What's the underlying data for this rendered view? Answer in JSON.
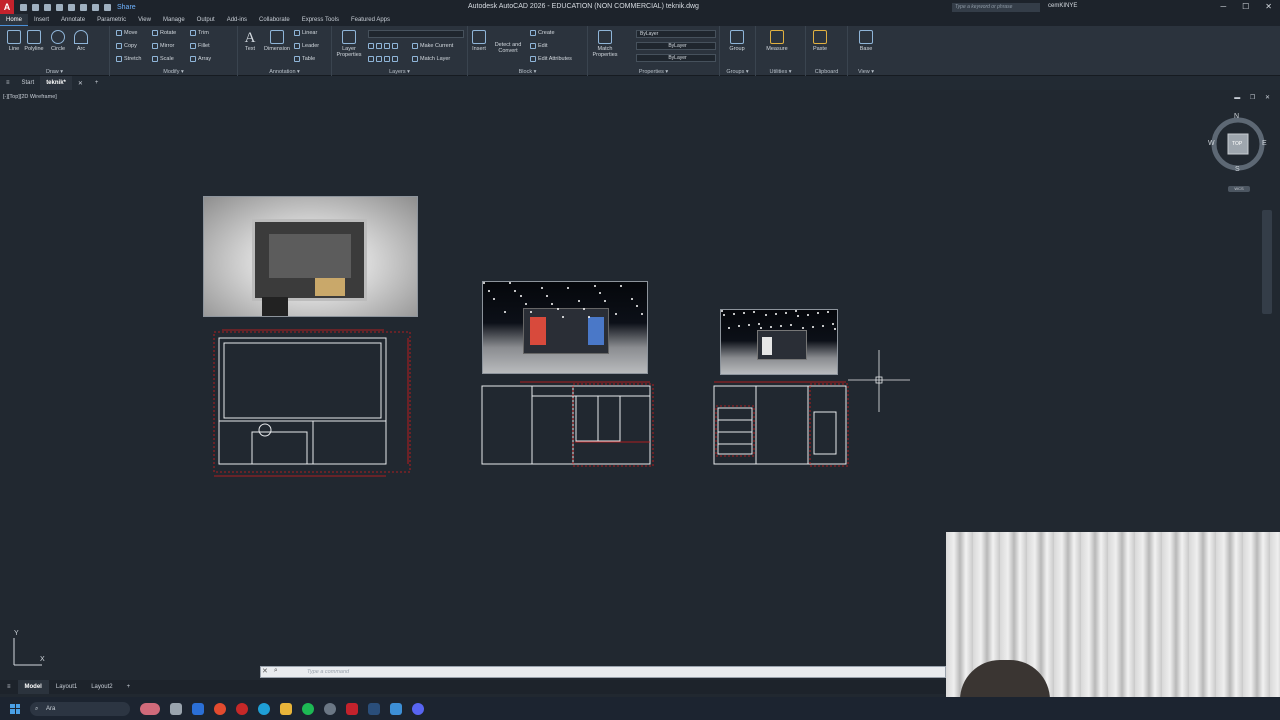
{
  "title_bar": {
    "app_icon": "A",
    "share_label": "Share",
    "window_title": "Autodesk AutoCAD 2026 - EDUCATION (NON COMMERCIAL)   teknik.dwg",
    "search_placeholder": "Type a keyword or phrase",
    "user_name": "cemKINYE",
    "minimize": "─",
    "maximize": "☐",
    "close": "✕"
  },
  "ribbon_tabs": [
    "Home",
    "Insert",
    "Annotate",
    "Parametric",
    "View",
    "Manage",
    "Output",
    "Add-ins",
    "Collaborate",
    "Express Tools",
    "Featured Apps"
  ],
  "ribbon": {
    "draw": {
      "title": "Draw ▾",
      "line": "Line",
      "polyline": "Polyline",
      "circle": "Circle",
      "arc": "Arc"
    },
    "modify": {
      "title": "Modify ▾",
      "move": "Move",
      "rotate": "Rotate",
      "trim": "Trim",
      "copy": "Copy",
      "mirror": "Mirror",
      "fillet": "Fillet",
      "stretch": "Stretch",
      "scale": "Scale",
      "array": "Array"
    },
    "annotation": {
      "title": "Annotation ▾",
      "text": "Text",
      "dimension": "Dimension",
      "linear": "Linear",
      "leader": "Leader",
      "table": "Table"
    },
    "layers": {
      "title": "Layers ▾",
      "layer_properties": "Layer Properties",
      "make_current": "Make Current",
      "match_layer": "Match Layer"
    },
    "block": {
      "title": "Block ▾",
      "insert": "Insert",
      "detect_convert": "Detect and Convert",
      "create": "Create",
      "edit": "Edit",
      "edit_attributes": "Edit Attributes"
    },
    "properties": {
      "title": "Properties ▾",
      "match_properties": "Match Properties",
      "bylayer1": "ByLayer",
      "bylayer2": "ByLayer",
      "bylayer3": "ByLayer"
    },
    "groups": {
      "title": "Groups ▾",
      "group": "Group"
    },
    "utilities": {
      "title": "Utilities ▾",
      "measure": "Measure"
    },
    "clipboard": {
      "title": "Clipboard",
      "paste": "Paste"
    },
    "view": {
      "title": "View ▾",
      "base": "Base"
    }
  },
  "file_tabs": [
    "Start",
    "teknik*"
  ],
  "file_tab_close": "✕",
  "file_tab_add": "+",
  "viewport": {
    "label": "[-][Top][2D Wireframe]",
    "controls": "▬ ❐ ✕",
    "viewcube": {
      "n": "N",
      "s": "S",
      "e": "E",
      "w": "W",
      "face": "TOP",
      "wcs": "WCS"
    },
    "ucs_x": "X",
    "ucs_y": "Y"
  },
  "command_line": {
    "placeholder": "Type a command"
  },
  "layout_tabs": [
    "Model",
    "Layout1",
    "Layout2"
  ],
  "layout_add": "+",
  "taskbar": {
    "search": "Ara"
  },
  "colors": {
    "viewport_bg": "#212830",
    "ribbon_bg": "#2b333d",
    "dim_red": "#d81b1b",
    "accent": "#4a90d9"
  }
}
